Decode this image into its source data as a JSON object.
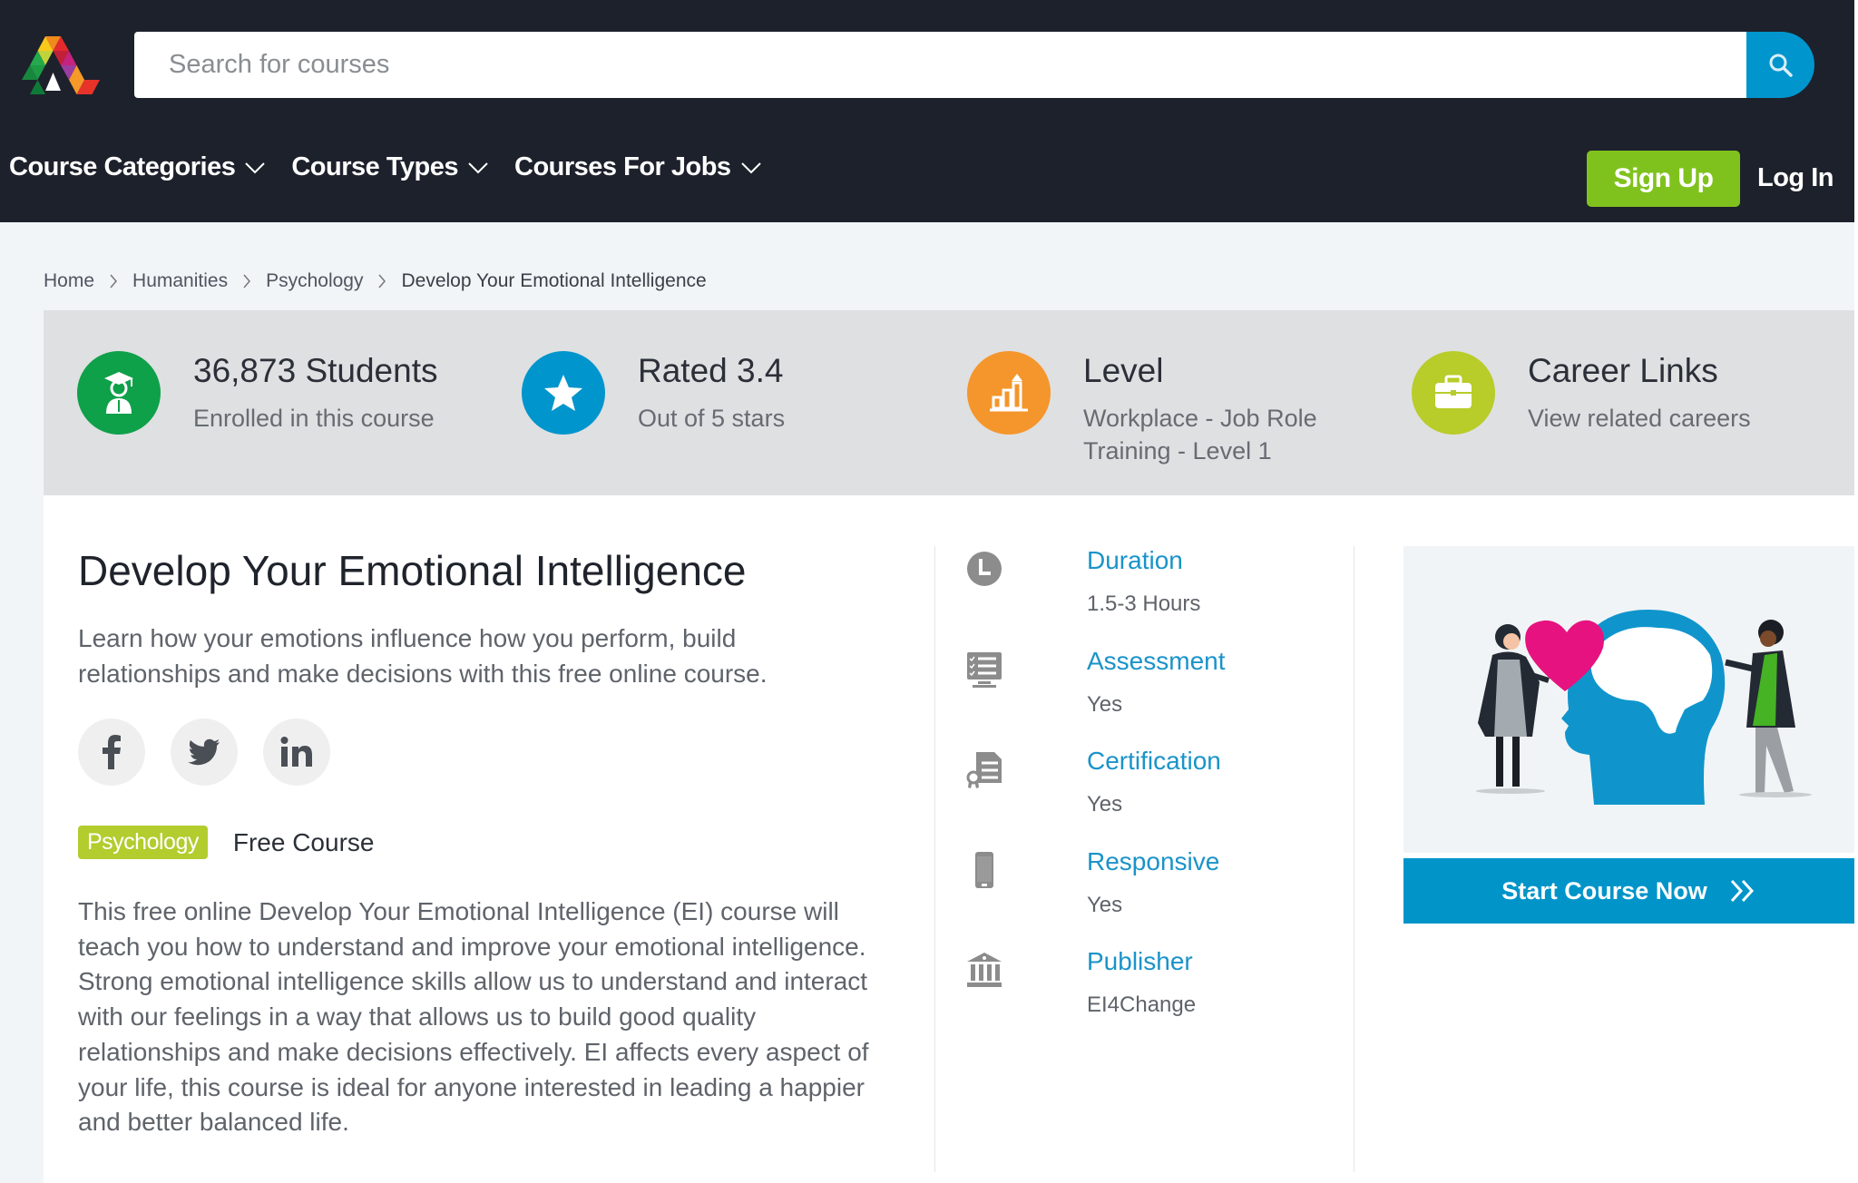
{
  "header": {
    "logo": "alison-logo",
    "search": {
      "placeholder": "Search for courses",
      "value": ""
    },
    "nav": [
      {
        "label": "Course Categories",
        "icon": "chevron-down-icon"
      },
      {
        "label": "Course Types",
        "icon": "chevron-down-icon"
      },
      {
        "label": "Courses For Jobs",
        "icon": "chevron-down-icon"
      }
    ],
    "signup_label": "Sign Up",
    "login_label": "Log In"
  },
  "breadcrumb": [
    "Home",
    "Humanities",
    "Psychology",
    "Develop Your Emotional Intelligence"
  ],
  "stats": [
    {
      "title": "36,873 Students",
      "sub": "Enrolled in this course",
      "icon": "graduate-icon",
      "color": "#0fa04a"
    },
    {
      "title": "Rated 3.4",
      "sub": "Out of 5 stars",
      "icon": "star-icon",
      "color": "#0095cc"
    },
    {
      "title": "Level",
      "sub": "Workplace - Job Role Training - Level 1",
      "icon": "level-chart-icon",
      "color": "#f4962b"
    },
    {
      "title": "Career Links",
      "sub": "View related careers",
      "icon": "briefcase-icon",
      "color": "#b8cc2a"
    }
  ],
  "course": {
    "title": "Develop Your Emotional Intelligence",
    "lead": "Learn how your emotions influence how you perform, build relationships and make decisions with this free online course.",
    "socials": [
      "f",
      "twitter",
      "in"
    ],
    "tag": "Psychology",
    "price_label": "Free Course",
    "description": "This free online Develop Your Emotional Intelligence (EI) course will teach you how to understand and improve your emotional intelligence. Strong emotional intelligence skills allow us to understand and interact with our feelings in a way that allows us to build good quality relationships and make decisions effectively. EI affects every aspect of your life, this course is ideal for anyone interested in leading a happier and better balanced life."
  },
  "info": [
    {
      "label": "Duration",
      "value": "1.5-3 Hours",
      "icon": "clock-icon"
    },
    {
      "label": "Assessment",
      "value": "Yes",
      "icon": "assessment-icon"
    },
    {
      "label": "Certification",
      "value": "Yes",
      "icon": "certificate-icon"
    },
    {
      "label": "Responsive",
      "value": "Yes",
      "icon": "mobile-icon"
    },
    {
      "label": "Publisher",
      "value": "EI4Change",
      "icon": "institution-icon"
    }
  ],
  "cta": {
    "label": "Start Course Now",
    "icon": "double-chevron-right-icon"
  },
  "colors": {
    "header_bg": "#1d212c",
    "accent_blue": "#0095cc",
    "signup_green": "#80c21d",
    "tag_green": "#b3cc2e",
    "link_blue": "#1a93c9"
  }
}
